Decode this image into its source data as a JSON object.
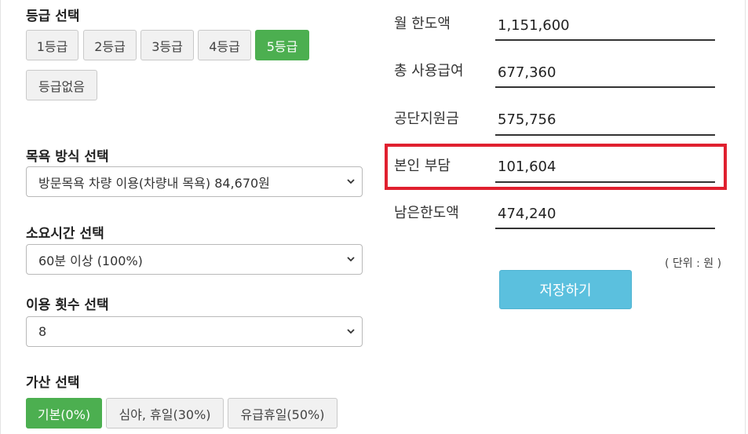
{
  "grade": {
    "title": "등급 선택",
    "options": [
      "1등급",
      "2등급",
      "3등급",
      "4등급",
      "5등급",
      "등급없음"
    ],
    "selected": "5등급"
  },
  "bath_method": {
    "title": "목욕 방식 선택",
    "value": "방문목욕 차량 이용(차량내 목욕) 84,670원"
  },
  "duration": {
    "title": "소요시간 선택",
    "value": "60분 이상 (100%)"
  },
  "usage_count": {
    "title": "이용 횟수 선택",
    "value": "8"
  },
  "surcharge": {
    "title": "가산 선택",
    "options": [
      "기본(0%)",
      "심야, 휴일(30%)",
      "유급휴일(50%)"
    ],
    "selected": "기본(0%)"
  },
  "summary": {
    "rows": [
      {
        "label": "월 한도액",
        "value": "1,151,600"
      },
      {
        "label": "총 사용급여",
        "value": "677,360"
      },
      {
        "label": "공단지원금",
        "value": "575,756"
      },
      {
        "label": "본인 부담",
        "value": "101,604"
      },
      {
        "label": "남은한도액",
        "value": "474,240"
      }
    ],
    "highlighted_row": "본인 부담",
    "highlight_color": "#e0202f",
    "unit_note": "( 단위 : 원 )",
    "save_label": "저장하기"
  },
  "colors": {
    "active_button": "#4caf50",
    "save_button": "#5bc0de"
  }
}
